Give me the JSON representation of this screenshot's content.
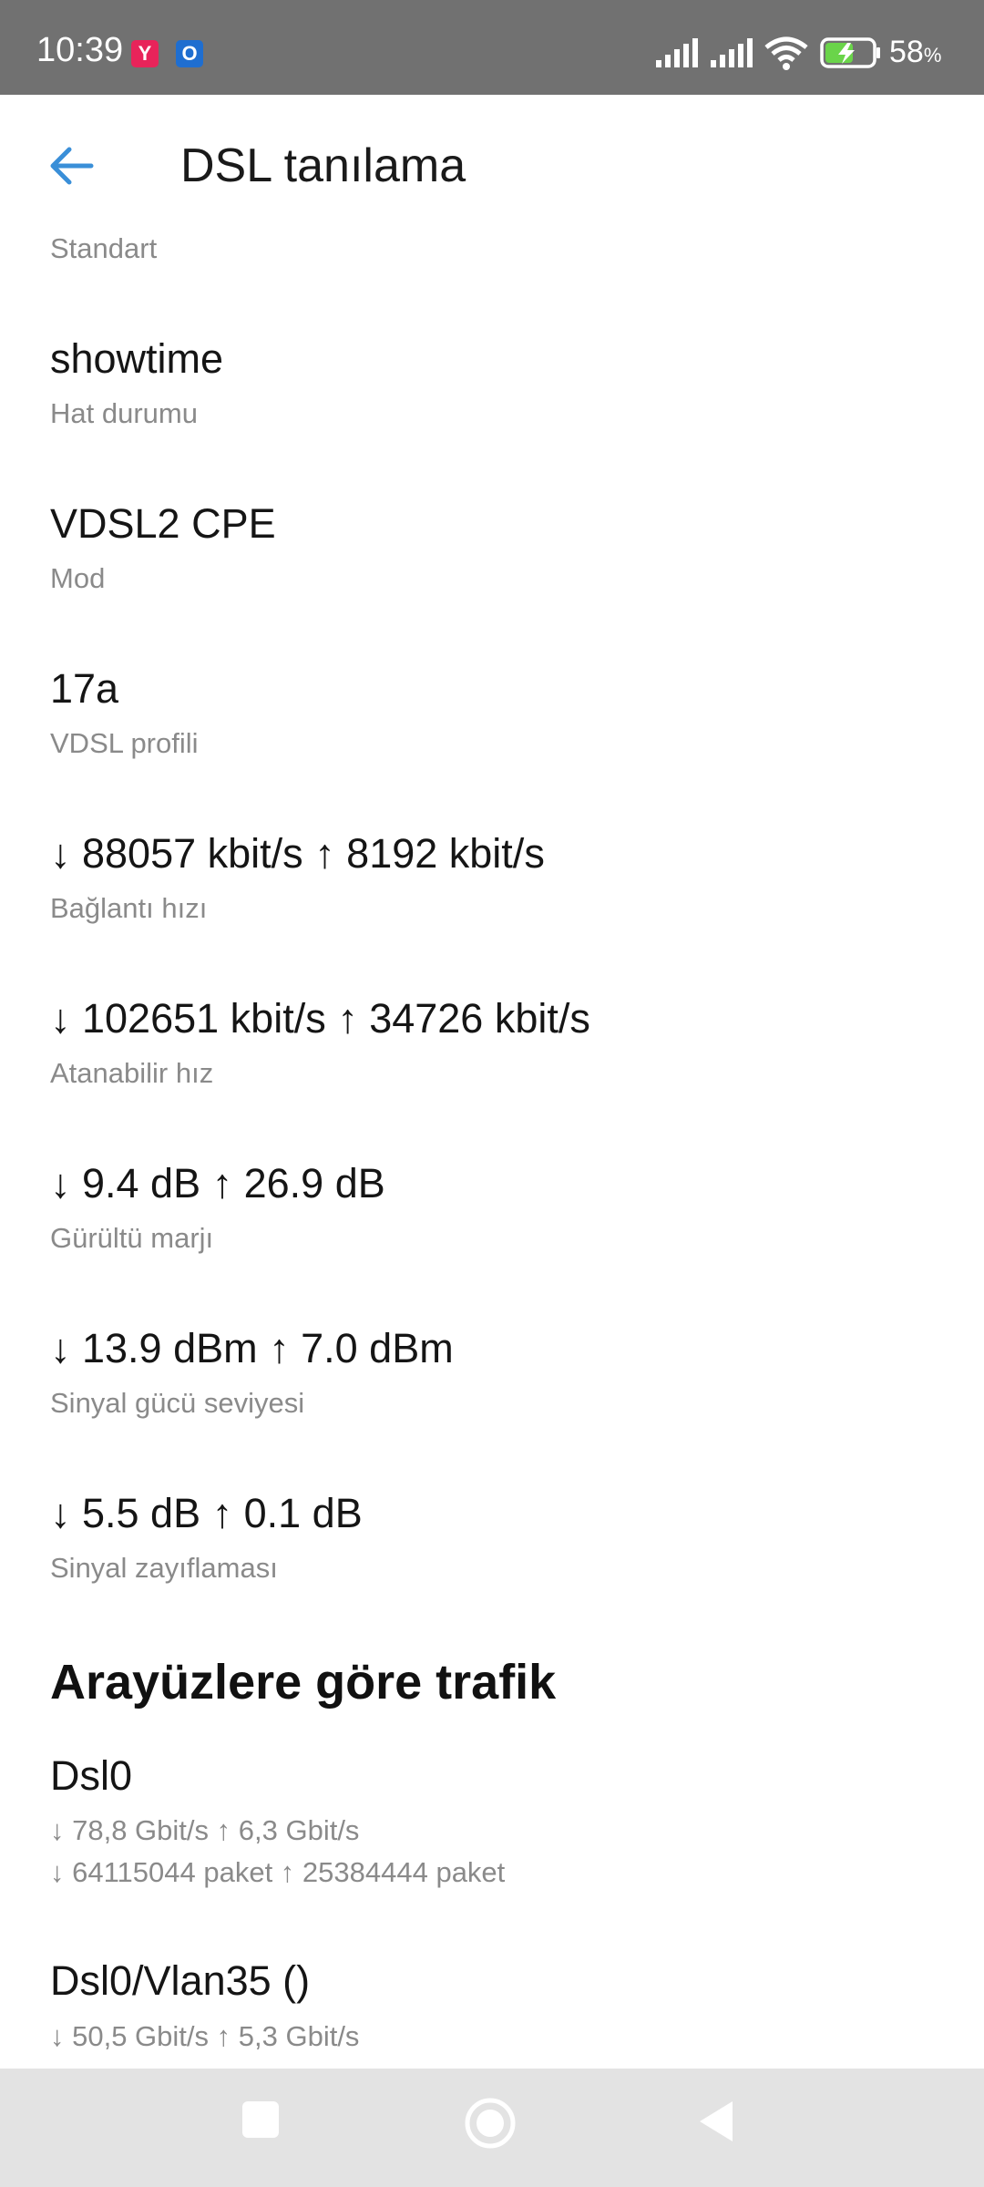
{
  "status_bar": {
    "time": "10:39",
    "app_icons": [
      {
        "name": "yandex-app-icon",
        "glyph": "Y",
        "color": "#e8245a"
      },
      {
        "name": "outlook-app-icon",
        "glyph": "O",
        "color": "#1f6ed0"
      }
    ],
    "battery_percent": "58",
    "battery_unit": "%"
  },
  "app_bar": {
    "title": "DSL tanılama"
  },
  "items": [
    {
      "value": "",
      "label": "Standart"
    },
    {
      "value": "showtime",
      "label": "Hat durumu"
    },
    {
      "value": "VDSL2 CPE",
      "label": "Mod"
    },
    {
      "value": "17a",
      "label": "VDSL profili"
    },
    {
      "value": "↓ 88057 kbit/s ↑ 8192 kbit/s",
      "label": "Bağlantı hızı"
    },
    {
      "value": "↓ 102651 kbit/s ↑ 34726 kbit/s",
      "label": "Atanabilir hız"
    },
    {
      "value": "↓ 9.4 dB ↑ 26.9 dB",
      "label": "Gürültü marjı"
    },
    {
      "value": "↓ 13.9 dBm ↑ 7.0 dBm",
      "label": "Sinyal gücü seviyesi"
    },
    {
      "value": "↓ 5.5 dB ↑ 0.1 dB",
      "label": "Sinyal zayıflaması"
    }
  ],
  "traffic_section": {
    "title": "Arayüzlere göre trafik",
    "interfaces": [
      {
        "name": "Dsl0",
        "rate": "↓ 78,8 Gbit/s ↑ 6,3 Gbit/s",
        "packets": "↓ 64115044 paket ↑ 25384444 paket"
      },
      {
        "name": "Dsl0/Vlan35 ()",
        "rate": "↓ 50,5 Gbit/s ↑ 5,3 Gbit/s"
      }
    ]
  },
  "colors": {
    "status_bar_bg": "#717171",
    "accent": "#3a8fd8",
    "nav_bar_bg": "#e3e3e3"
  }
}
